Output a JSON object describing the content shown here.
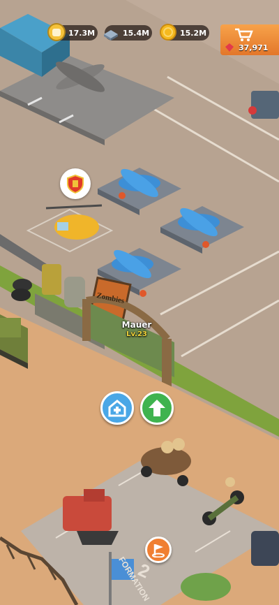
{
  "resources": {
    "power": {
      "value": "17.3M",
      "icon": "fist-icon"
    },
    "steel": {
      "value": "15.4M",
      "icon": "steel-ingot-icon"
    },
    "gold": {
      "value": "15.2M",
      "icon": "gold-coin-icon"
    }
  },
  "shop": {
    "gems": "37,971",
    "icon": "shop-cart-icon"
  },
  "gate": {
    "name": "Mauer",
    "level": "Lv.23"
  },
  "buttons": {
    "home": "home-plus-icon",
    "upgrade": "arrow-up-icon",
    "formation_flag": "flag-icon"
  },
  "signs": {
    "zombies": "Zombies",
    "formation": "FORMATION",
    "slot": "2"
  },
  "colors": {
    "ground": "#b9a492",
    "sand": "#dba97a",
    "accent_green": "#3fb34f",
    "accent_blue": "#4aa7e6",
    "accent_orange": "#f07f32"
  }
}
